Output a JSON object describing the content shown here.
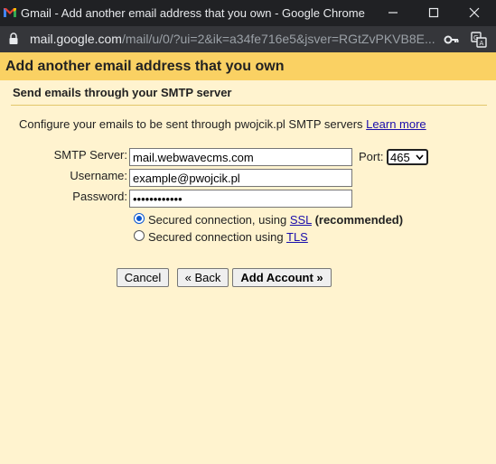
{
  "window": {
    "title": "Gmail - Add another email address that you own - Google Chrome",
    "brand_color": "#ea4335"
  },
  "address_bar": {
    "url_host": "mail.google.com",
    "url_path": "/mail/u/0/?ui=2&ik=a34fe716e5&jsver=RGtZvPKVB8E..."
  },
  "page": {
    "heading": "Add another email address that you own",
    "subheading": "Send emails through your SMTP server",
    "description": "Configure your emails to be sent through pwojcik.pl SMTP servers",
    "learn_more": "Learn more",
    "accent_bar_color": "#fad163",
    "background_color": "#fff3cf"
  },
  "form": {
    "smtp_label": "SMTP Server:",
    "smtp_value": "mail.webwavecms.com",
    "port_label": "Port:",
    "port_value": "465",
    "username_label": "Username:",
    "username_value": "example@pwojcik.pl",
    "password_label": "Password:",
    "password_value": "••••••••••••",
    "ssl_option": {
      "prefix": "Secured connection, using",
      "link": "SSL",
      "suffix": "(recommended)",
      "checked": true
    },
    "tls_option": {
      "prefix": "Secured connection using",
      "link": "TLS",
      "checked": false
    }
  },
  "buttons": {
    "cancel": "Cancel",
    "back": "« Back",
    "add_account": "Add Account »"
  }
}
